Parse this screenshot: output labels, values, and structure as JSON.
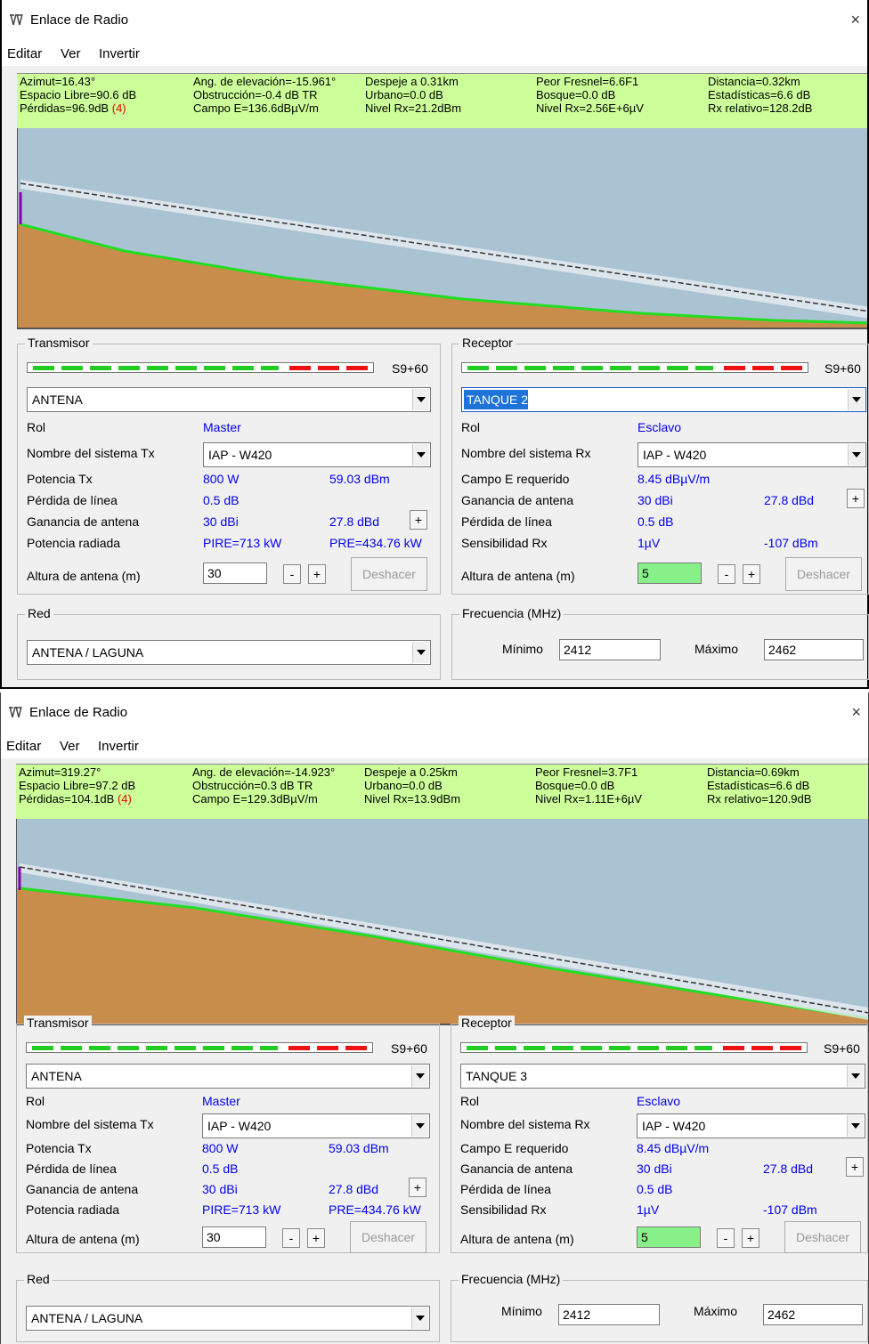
{
  "app": {
    "title": "Enlace de Radio",
    "menu": [
      "Editar",
      "Ver",
      "Invertir"
    ],
    "close": "×"
  },
  "windows": [
    {
      "stats": {
        "azimut": "Azimut=16.43°",
        "espacio_libre": "Espacio Libre=90.6 dB",
        "perdidas": "Pérdidas=96.9dB",
        "perdidas_flag": "(4)",
        "elevacion": "Ang. de elevación=-15.961°",
        "obstruccion": "Obstrucción=-0.4 dB TR",
        "campo_e": "Campo E=136.6dBµV/m",
        "despeje": "Despeje a 0.31km",
        "urbano": "Urbano=0.0 dB",
        "nivel_rx_dbm": "Nivel Rx=21.2dBm",
        "peor_fresnel": "Peor Fresnel=6.6F1",
        "bosque": "Bosque=0.0 dB",
        "nivel_rx_uv": "Nivel Rx=2.56E+6µV",
        "distancia": "Distancia=0.32km",
        "estadisticas": "Estadísticas=6.6 dB",
        "rx_relativo": "Rx relativo=128.2dB"
      },
      "transmisor": {
        "legend": "Transmisor",
        "meter_label": "S9+60",
        "station": "ANTENA",
        "rol_label": "Rol",
        "rol_value": "Master",
        "sistema_label": "Nombre del sistema Tx",
        "sistema_value": "IAP - W420",
        "potencia_label": "Potencia Tx",
        "potencia_w": "800 W",
        "potencia_dbm": "59.03 dBm",
        "perdida_label": "Pérdida de línea",
        "perdida_value": "0.5 dB",
        "ganancia_label": "Ganancia de antena",
        "ganancia_dbi": "30 dBi",
        "ganancia_dbd": "27.8 dBd",
        "radiada_label": "Potencia radiada",
        "pire": "PIRE=713 kW",
        "pre": "PRE=434.76 kW",
        "altura_label": "Altura de antena (m)",
        "altura_value": "30",
        "minus": "-",
        "plus": "+",
        "deshacer": "Deshacer"
      },
      "receptor": {
        "legend": "Receptor",
        "meter_label": "S9+60",
        "station": "TANQUE 2",
        "rol_label": "Rol",
        "rol_value": "Esclavo",
        "sistema_label": "Nombre del sistema Rx",
        "sistema_value": "IAP - W420",
        "campo_label": "Campo E requerido",
        "campo_value": "8.45 dBµV/m",
        "ganancia_label": "Ganancia de antena",
        "ganancia_dbi": "30 dBi",
        "ganancia_dbd": "27.8 dBd",
        "perdida_label": "Pérdida de línea",
        "perdida_value": "0.5 dB",
        "sens_label": "Sensibilidad Rx",
        "sens_uv": "1µV",
        "sens_dbm": "-107 dBm",
        "altura_label": "Altura de antena (m)",
        "altura_value": "5",
        "minus": "-",
        "plus": "+",
        "deshacer": "Deshacer"
      },
      "red": {
        "legend": "Red",
        "value": "ANTENA / LAGUNA"
      },
      "frecuencia": {
        "legend": "Frecuencia (MHz)",
        "min_label": "Mínimo",
        "min_value": "2412",
        "max_label": "Máximo",
        "max_value": "2462"
      }
    },
    {
      "stats": {
        "azimut": "Azimut=319.27°",
        "espacio_libre": "Espacio Libre=97.2 dB",
        "perdidas": "Pérdidas=104.1dB",
        "perdidas_flag": "(4)",
        "elevacion": "Ang. de elevación=-14.923°",
        "obstruccion": "Obstrucción=0.3 dB TR",
        "campo_e": "Campo E=129.3dBµV/m",
        "despeje": "Despeje a 0.25km",
        "urbano": "Urbano=0.0 dB",
        "nivel_rx_dbm": "Nivel Rx=13.9dBm",
        "peor_fresnel": "Peor Fresnel=3.7F1",
        "bosque": "Bosque=0.0 dB",
        "nivel_rx_uv": "Nivel Rx=1.11E+6µV",
        "distancia": "Distancia=0.69km",
        "estadisticas": "Estadísticas=6.6 dB",
        "rx_relativo": "Rx relativo=120.9dB"
      },
      "transmisor": {
        "legend": "Transmisor",
        "meter_label": "S9+60",
        "station": "ANTENA",
        "rol_label": "Rol",
        "rol_value": "Master",
        "sistema_label": "Nombre del sistema Tx",
        "sistema_value": "IAP - W420",
        "potencia_label": "Potencia Tx",
        "potencia_w": "800 W",
        "potencia_dbm": "59.03 dBm",
        "perdida_label": "Pérdida de línea",
        "perdida_value": "0.5 dB",
        "ganancia_label": "Ganancia de antena",
        "ganancia_dbi": "30 dBi",
        "ganancia_dbd": "27.8 dBd",
        "radiada_label": "Potencia radiada",
        "pire": "PIRE=713 kW",
        "pre": "PRE=434.76 kW",
        "altura_label": "Altura de antena (m)",
        "altura_value": "30",
        "minus": "-",
        "plus": "+",
        "deshacer": "Deshacer"
      },
      "receptor": {
        "legend": "Receptor",
        "meter_label": "S9+60",
        "station": "TANQUE 3",
        "rol_label": "Rol",
        "rol_value": "Esclavo",
        "sistema_label": "Nombre del sistema Rx",
        "sistema_value": "IAP - W420",
        "campo_label": "Campo E requerido",
        "campo_value": "8.45 dBµV/m",
        "ganancia_label": "Ganancia de antena",
        "ganancia_dbi": "30 dBi",
        "ganancia_dbd": "27.8 dBd",
        "perdida_label": "Pérdida de línea",
        "perdida_value": "0.5 dB",
        "sens_label": "Sensibilidad Rx",
        "sens_uv": "1µV",
        "sens_dbm": "-107 dBm",
        "altura_label": "Altura de antena (m)",
        "altura_value": "5",
        "minus": "-",
        "plus": "+",
        "deshacer": "Deshacer"
      },
      "red": {
        "legend": "Red",
        "value": "ANTENA / LAGUNA"
      },
      "frecuencia": {
        "legend": "Frecuencia (MHz)",
        "min_label": "Mínimo",
        "min_value": "2412",
        "max_label": "Máximo",
        "max_value": "2462"
      }
    }
  ],
  "colors": {
    "stats_bg": "#ccff99",
    "sky": "#a9c3d3",
    "terrain": "#c98d4b",
    "terrain_edge": "#22dd22",
    "meter_green": "#22cc22",
    "meter_red": "#ee1111",
    "value_blue": "#0000ee",
    "selection": "#1e73d8",
    "height_field": "#88f088"
  },
  "icons": {
    "app": "radio-link-icon",
    "dropdown": "chevron-down-icon",
    "close": "close-icon"
  }
}
